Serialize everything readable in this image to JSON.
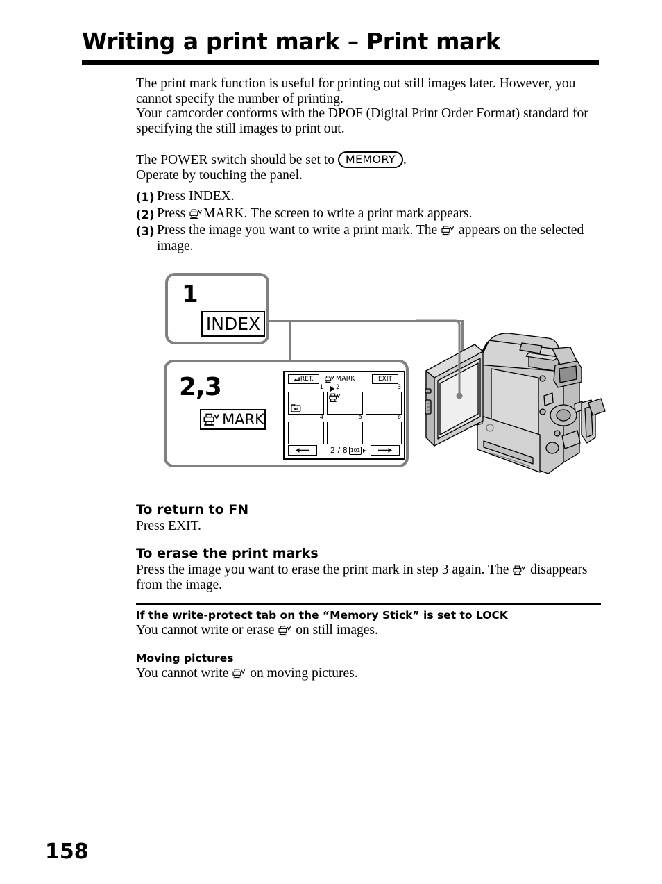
{
  "page": {
    "title": "Writing a print mark – Print mark",
    "number": "158"
  },
  "intro": {
    "p1": "The print mark function is useful for printing out still images later. However, you cannot specify the number of printing.",
    "p2": "Your camcorder conforms with the DPOF (Digital Print Order Format) standard for specifying the still images to print out.",
    "power_prefix": "The POWER switch should be set to ",
    "power_value": "MEMORY",
    "power_suffix": ".",
    "operate": "Operate by touching the panel."
  },
  "steps": [
    {
      "num": "(1)",
      "text": "Press INDEX."
    },
    {
      "num": "(2)",
      "pre": "Press ",
      "icon": "print-mark-icon",
      "post": "MARK. The screen to write a print mark appears."
    },
    {
      "num": "(3)",
      "pre": "Press the image you want to write a print mark. The ",
      "icon": "print-mark-icon",
      "post": " appears on the selected image."
    }
  ],
  "diagram": {
    "box1_label": "1",
    "box1_key": "INDEX",
    "box23_label": "2,3",
    "box23_key": "MARK",
    "lcd": {
      "ret_button": "RET.",
      "mark_label": "MARK",
      "exit_button": "EXIT",
      "thumbnails": [
        {
          "label": "1",
          "selected": false,
          "has_folder_icon": true,
          "has_print_mark": false
        },
        {
          "label": "2",
          "selected": true,
          "has_folder_icon": false,
          "has_print_mark": true
        },
        {
          "label": "3",
          "selected": false,
          "has_folder_icon": false,
          "has_print_mark": false
        },
        {
          "label": "4",
          "selected": false,
          "has_folder_icon": false,
          "has_print_mark": false
        },
        {
          "label": "5",
          "selected": false,
          "has_folder_icon": false,
          "has_print_mark": false
        },
        {
          "label": "6",
          "selected": false,
          "has_folder_icon": false,
          "has_print_mark": false
        }
      ],
      "page_counter": "2 / 8",
      "folder_tag": "101",
      "prev_label": "prev-arrow-icon",
      "next_label": "next-arrow-icon"
    }
  },
  "sections": [
    {
      "heading": "To return to FN",
      "body": "Press EXIT."
    },
    {
      "heading": "To erase the print marks",
      "body_pre": "Press the image you want to erase the print mark in step 3 again. The ",
      "body_post": " disappears from the image."
    },
    {
      "heading": "If the write-protect tab on the “Memory Stick” is set to LOCK",
      "body_pre": "You cannot write or erase ",
      "body_post": " on still images."
    },
    {
      "heading": "Moving pictures",
      "body_pre": "You cannot write ",
      "body_post": " on moving pictures."
    }
  ],
  "colors": {
    "text": "#000000",
    "connector": "#808080",
    "box_border": "#808080",
    "illustration_fill": "#c8c8c8"
  }
}
